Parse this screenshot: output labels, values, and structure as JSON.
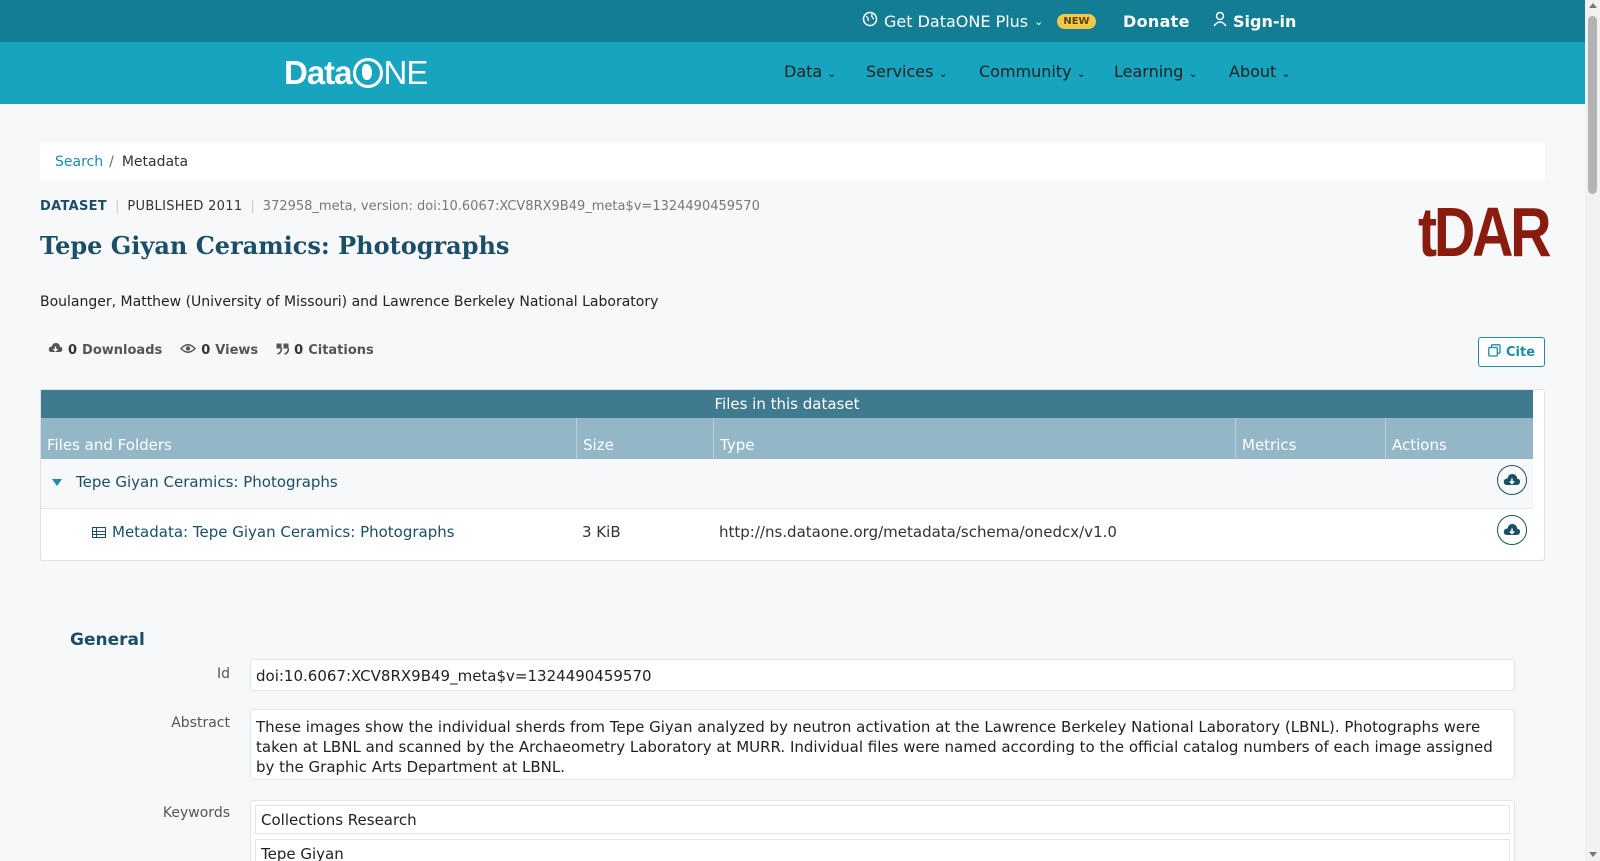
{
  "topbar": {
    "plus_label": "Get DataONE Plus",
    "new_badge": "NEW",
    "donate_label": "Donate",
    "signin_label": "Sign-in"
  },
  "nav": {
    "logo_left": "Data",
    "logo_right": "NE",
    "items": [
      {
        "label": "Data"
      },
      {
        "label": "Services"
      },
      {
        "label": "Community"
      },
      {
        "label": "Learning"
      },
      {
        "label": "About"
      }
    ]
  },
  "breadcrumb": {
    "search": "Search",
    "separator": "/",
    "current": "Metadata"
  },
  "dataset": {
    "type": "DATASET",
    "published": "PUBLISHED 2011",
    "version": "372958_meta, version: doi:10.6067:XCV8RX9B49_meta$v=1324490459570",
    "title": "Tepe Giyan Ceramics: Photographs",
    "repository_logo": "tDAR",
    "authors": "Boulanger, Matthew (University of Missouri) and Lawrence Berkeley National Laboratory",
    "metrics": {
      "downloads_count": "0",
      "downloads_label": "Downloads",
      "views_count": "0",
      "views_label": "Views",
      "citations_count": "0",
      "citations_label": "Citations"
    },
    "cite_label": "Cite"
  },
  "files": {
    "heading": "Files in this dataset",
    "columns": [
      "Files and Folders",
      "Size",
      "Type",
      "Metrics",
      "Actions"
    ],
    "folder": {
      "name": "Tepe Giyan Ceramics: Photographs"
    },
    "rows": [
      {
        "name": "Metadata: Tepe Giyan Ceramics: Photographs",
        "size": "3 KiB",
        "type": "http://ns.dataone.org/metadata/schema/onedcx/v1.0"
      }
    ]
  },
  "general": {
    "heading": "General",
    "id_label": "Id",
    "id_value": "doi:10.6067:XCV8RX9B49_meta$v=1324490459570",
    "abstract_label": "Abstract",
    "abstract_value": "These images show the individual sherds from Tepe Giyan analyzed by neutron activation at the Lawrence Berkeley National Laboratory (LBNL). Photographs were taken at LBNL and scanned by the Archaeometry Laboratory at MURR. Individual files were named according to the official catalog numbers of each image assigned by the Graphic Arts Department at LBNL.",
    "keywords_label": "Keywords",
    "keywords": [
      "Collections Research",
      "Tepe Giyan"
    ]
  },
  "colors": {
    "topbar": "#137d94",
    "navbar": "#17a4bf",
    "title": "#1b4f66",
    "tdar": "#8a1c0f"
  }
}
